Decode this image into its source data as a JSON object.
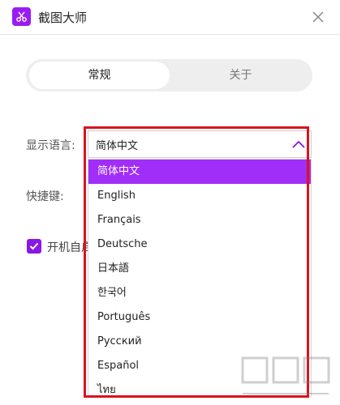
{
  "app": {
    "title": "截图大师"
  },
  "tabs": [
    {
      "label": "常规",
      "active": true
    },
    {
      "label": "关于",
      "active": false
    }
  ],
  "settings": {
    "language_label": "显示语言:",
    "hotkey_label": "快捷键:",
    "autostart_label": "开机自启",
    "autostart_checked": true
  },
  "language_select": {
    "selected": "简体中文",
    "options": [
      "简体中文",
      "English",
      "Français",
      "Deutsche",
      "日本語",
      "한국어",
      "Português",
      "Русский",
      "Español",
      "ไทย"
    ]
  },
  "colors": {
    "accent": "#9b1cf2",
    "highlight": "#a12df8",
    "outline": "#d9141f"
  },
  "icons": {
    "app": "scissors-icon",
    "close": "close-icon",
    "dropdown": "chevron-up-icon",
    "check": "check-icon"
  }
}
